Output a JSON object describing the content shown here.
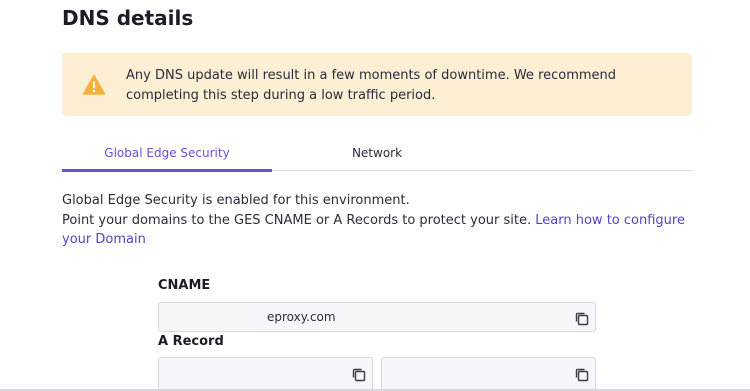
{
  "page": {
    "title": "DNS details"
  },
  "alert": {
    "icon": "warning-icon",
    "message": "Any DNS update will result in a few moments of downtime. We recommend completing this step during a low traffic period.",
    "background": "#fdefd4",
    "icon_color": "#f5b13d"
  },
  "tabs": [
    {
      "label": "Global Edge Security",
      "active": true
    },
    {
      "label": "Network",
      "active": false
    }
  ],
  "description": {
    "line1": "Global Edge Security is enabled for this environment.",
    "line2": "Point your domains to the GES CNAME or A Records to protect your site.",
    "link_text": "Learn how to configure your Domain"
  },
  "cname": {
    "label": "CNAME",
    "value": "eproxy.com",
    "copy_icon": "copy-icon"
  },
  "a_record": {
    "label": "A Record",
    "values": [
      "",
      ""
    ],
    "copy_icon": "copy-icon"
  },
  "colors": {
    "accent": "#6a4fd0",
    "link": "#5b3ec8"
  }
}
